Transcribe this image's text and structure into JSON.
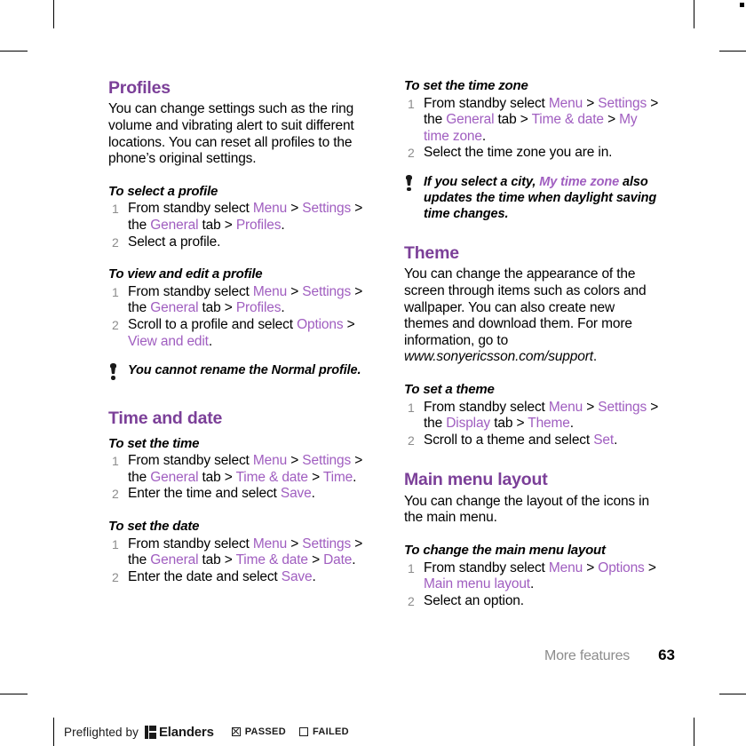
{
  "page": {
    "chapter": "More features",
    "number": "63"
  },
  "colors": {
    "heading_purple": "#7b3f98",
    "link_purple": "#a05ec0",
    "step_number_gray": "#8c8c8c",
    "chapter_gray": "#8c8c8c",
    "text_black": "#000000"
  },
  "left_column": {
    "profiles": {
      "title": "Profiles",
      "intro": "You can change settings such as the ring volume and vibrating alert to suit different locations. You can reset all profiles to the phone’s original settings.",
      "proc_select": {
        "title": "To select a profile",
        "step1": {
          "a": "From standby select ",
          "menu": "Menu",
          "gt1": " > ",
          "settings": "Settings",
          "b": " > the ",
          "general": "General",
          "c": " tab > ",
          "profiles": "Profiles",
          "period": "."
        },
        "step2": "Select a profile."
      },
      "proc_view_edit": {
        "title": "To view and edit a profile",
        "step1": {
          "a": "From standby select ",
          "menu": "Menu",
          "gt1": " > ",
          "settings": "Settings",
          "b": " > the ",
          "general": "General",
          "c": " tab > ",
          "profiles": "Profiles",
          "period": "."
        },
        "step2": {
          "a": "Scroll to a profile and select ",
          "options": "Options",
          "b": " > ",
          "view_and_edit": "View and edit",
          "period": "."
        }
      },
      "tip": "You cannot rename the Normal profile."
    },
    "time_and_date": {
      "title": "Time and date",
      "proc_set_time": {
        "title": "To set the time",
        "step1": {
          "a": "From standby select ",
          "menu": "Menu",
          "gt1": " > ",
          "settings": "Settings",
          "b": " > the ",
          "general": "General",
          "c": " tab > ",
          "time_and_date": "Time & date",
          "d": " > ",
          "time": "Time",
          "period": "."
        },
        "step2": {
          "a": "Enter the time and select ",
          "save": "Save",
          "period": "."
        }
      },
      "proc_set_date": {
        "title": "To set the date",
        "step1": {
          "a": "From standby select ",
          "menu": "Menu",
          "gt1": " > ",
          "settings": "Settings",
          "b": " > the ",
          "general": "General",
          "c": " tab > ",
          "time_and_date": "Time & date",
          "d": " > ",
          "date": "Date",
          "period": "."
        },
        "step2": {
          "a": "Enter the date and select ",
          "save": "Save",
          "period": "."
        }
      }
    }
  },
  "right_column": {
    "proc_set_time_zone": {
      "title": "To set the time zone",
      "step1": {
        "a": "From standby select ",
        "menu": "Menu",
        "gt1": " > ",
        "settings": "Settings",
        "b": " > the ",
        "general": "General",
        "c": " tab > ",
        "time_and_date": "Time & date",
        "d": " > ",
        "my_time_zone": "My time zone",
        "period": "."
      },
      "step2": "Select the time zone you are in."
    },
    "tip_timezone": {
      "a": "If you select a city, ",
      "my_time_zone": "My time zone",
      "b": " also updates the time when daylight saving time changes."
    },
    "theme": {
      "title": "Theme",
      "intro_a": "You can change the appearance of the screen through items such as colors and wallpaper. You can also create new themes and download them. For more information, go to ",
      "url": "www.sonyericsson.com/support",
      "intro_b": ".",
      "proc_set_theme": {
        "title": "To set a theme",
        "step1": {
          "a": "From standby select ",
          "menu": "Menu",
          "gt1": " > ",
          "settings": "Settings",
          "b": " > the ",
          "display": "Display",
          "c": " tab > ",
          "theme": "Theme",
          "period": "."
        },
        "step2": {
          "a": "Scroll to a theme and select ",
          "set": "Set",
          "period": "."
        }
      }
    },
    "main_menu_layout": {
      "title": "Main menu layout",
      "intro": "You can change the layout of the icons in the main menu.",
      "proc_change_layout": {
        "title": "To change the main menu layout",
        "step1": {
          "a": "From standby select ",
          "menu": "Menu",
          "gt1": " > ",
          "options": "Options",
          "b": " > ",
          "main_menu_layout": "Main menu layout",
          "period": "."
        },
        "step2": "Select an option."
      }
    }
  },
  "preflight": {
    "label": "Preflighted by",
    "logo_text": "Elanders",
    "passed": "PASSED",
    "failed": "FAILED"
  }
}
